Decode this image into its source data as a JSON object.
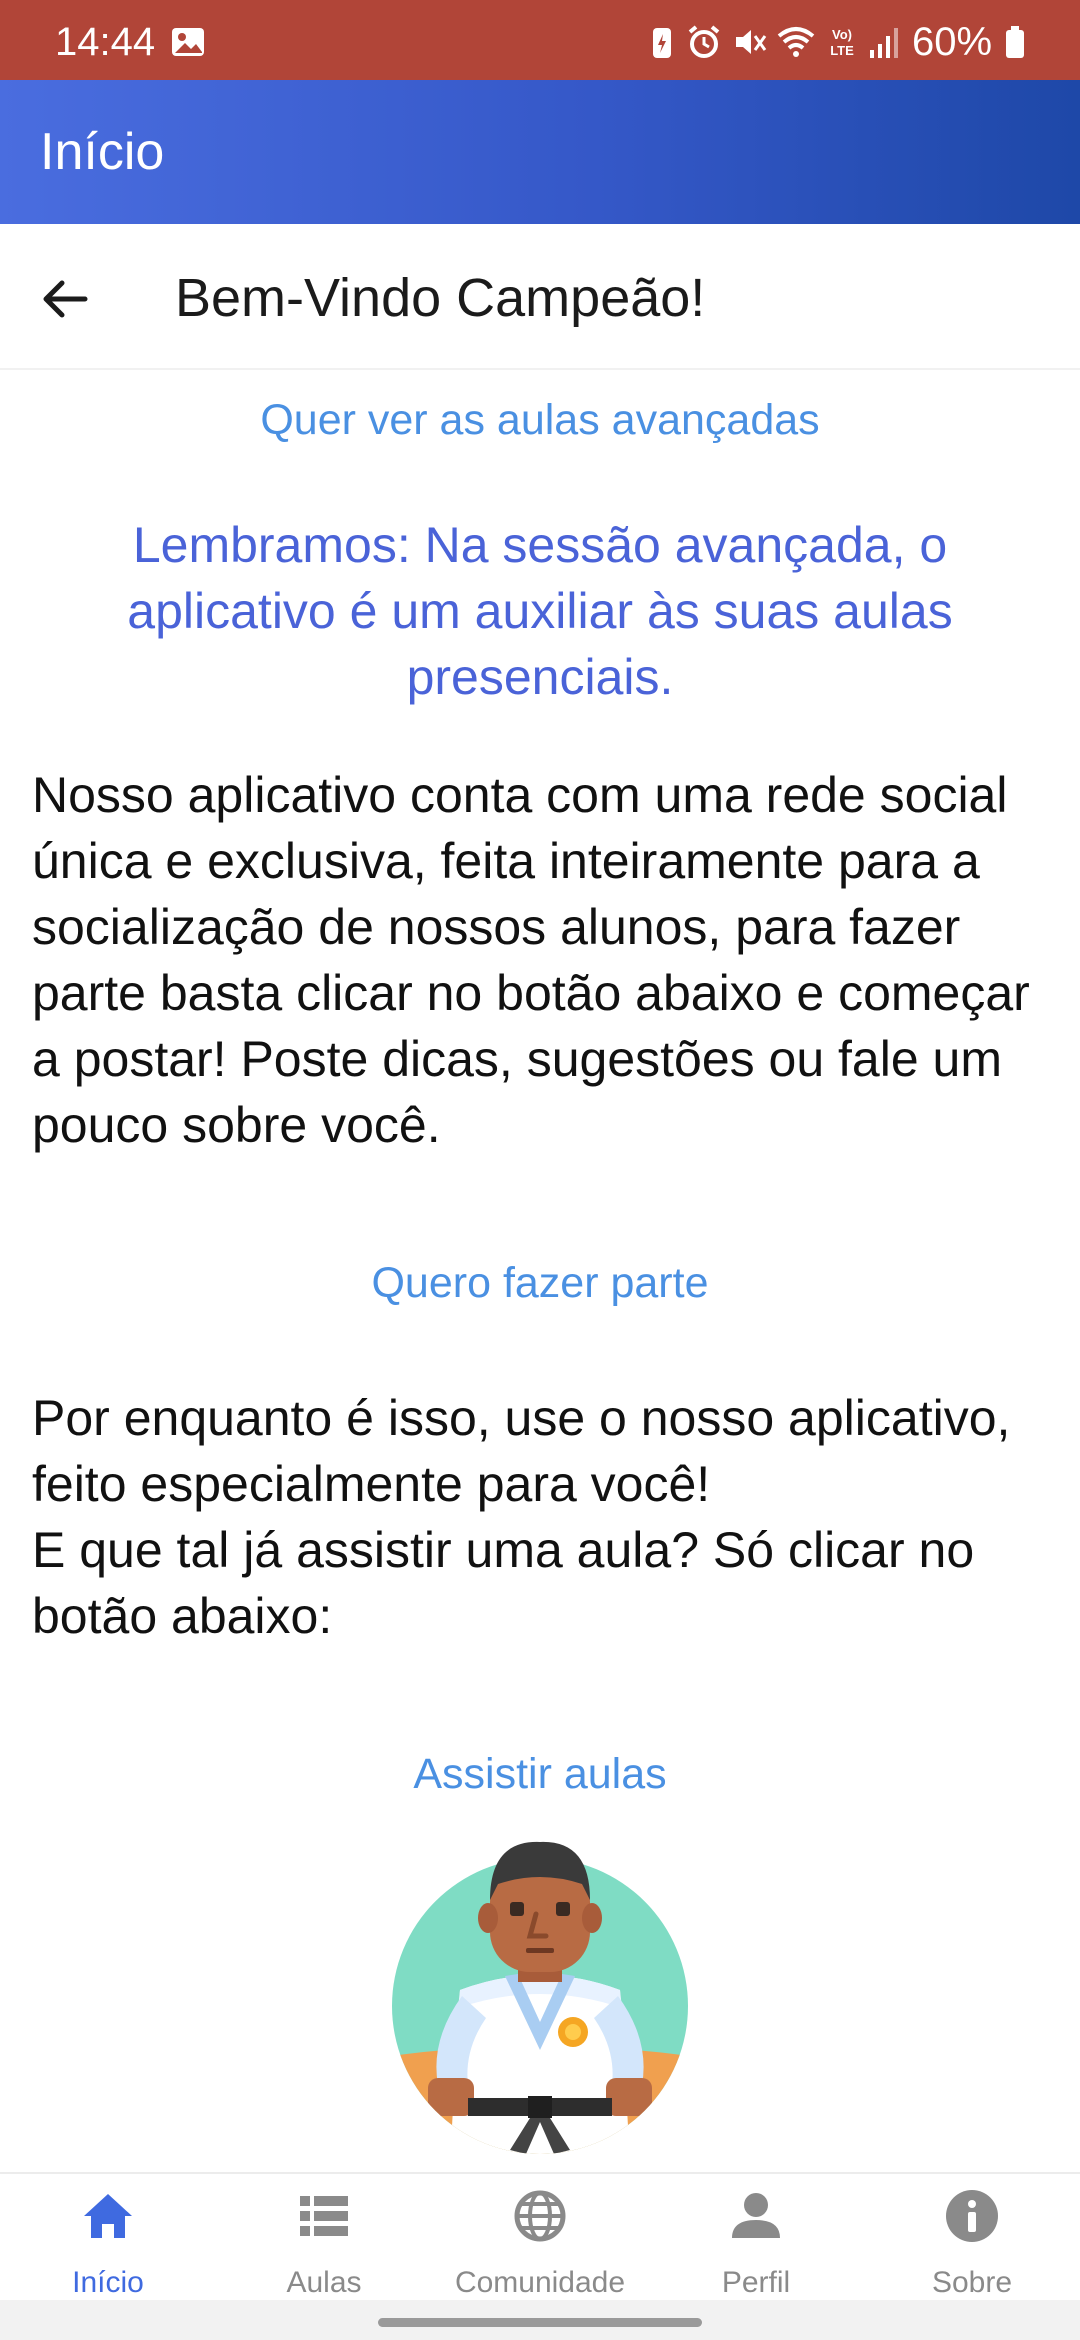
{
  "status_bar": {
    "time": "14:44",
    "battery": "60%",
    "bg_color": "#b14538"
  },
  "app_bar": {
    "title": "Início"
  },
  "sub_header": {
    "title": "Bem-Vindo Campeão!"
  },
  "content": {
    "advanced_link": "Quer ver as aulas avançadas",
    "reminder": "Lembramos: Na sessão avançada, o aplicativo é um auxiliar às suas aulas presenciais.",
    "social_paragraph": "Nosso aplicativo conta com uma rede social única e exclusiva, feita inteiramente para a socialização de nossos alunos, para fazer parte basta clicar no botão abaixo e começar a postar! Poste dicas, sugestões ou fale um pouco sobre você.",
    "join_link": "Quero fazer parte",
    "closing_line1": "Por enquanto é isso, use o nosso aplicativo, feito especialmente para você!",
    "closing_line2": "E que tal já assistir uma aula? Só clicar no botão abaixo:",
    "watch_link": "Assistir aulas"
  },
  "bottom_nav": {
    "items": [
      {
        "label": "Início",
        "icon": "home-icon",
        "active": true
      },
      {
        "label": "Aulas",
        "icon": "list-icon",
        "active": false
      },
      {
        "label": "Comunidade",
        "icon": "globe-icon",
        "active": false
      },
      {
        "label": "Perfil",
        "icon": "person-icon",
        "active": false
      },
      {
        "label": "Sobre",
        "icon": "info-icon",
        "active": false
      }
    ]
  },
  "colors": {
    "link": "#4a90e2",
    "reminder": "#4a63d8",
    "nav_active": "#3f6ae0",
    "nav_inactive": "#8a8a8a"
  }
}
